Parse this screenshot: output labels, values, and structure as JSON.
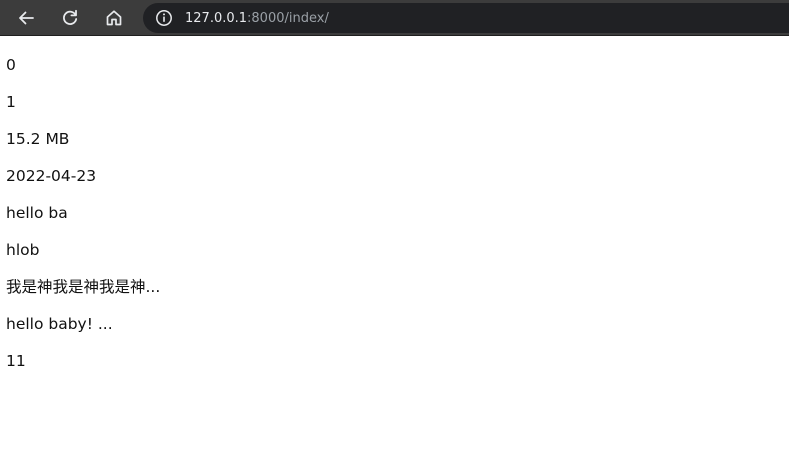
{
  "browser": {
    "address": {
      "host": "127.0.0.1",
      "path": ":8000/index/"
    },
    "icons": {
      "back": "back-arrow-icon",
      "reload": "reload-icon",
      "home": "home-icon",
      "info": "info-icon"
    },
    "colors": {
      "toolbar": "#3c3c3c",
      "omnibox": "#202124",
      "host_text": "#e8eaed",
      "path_text": "#9aa0a6"
    }
  },
  "page": {
    "lines": [
      "0",
      "1",
      "15.2 MB",
      "2022-04-23",
      "hello ba",
      "hlob",
      "我是神我是神我是神...",
      "hello baby! ...",
      "11"
    ]
  }
}
